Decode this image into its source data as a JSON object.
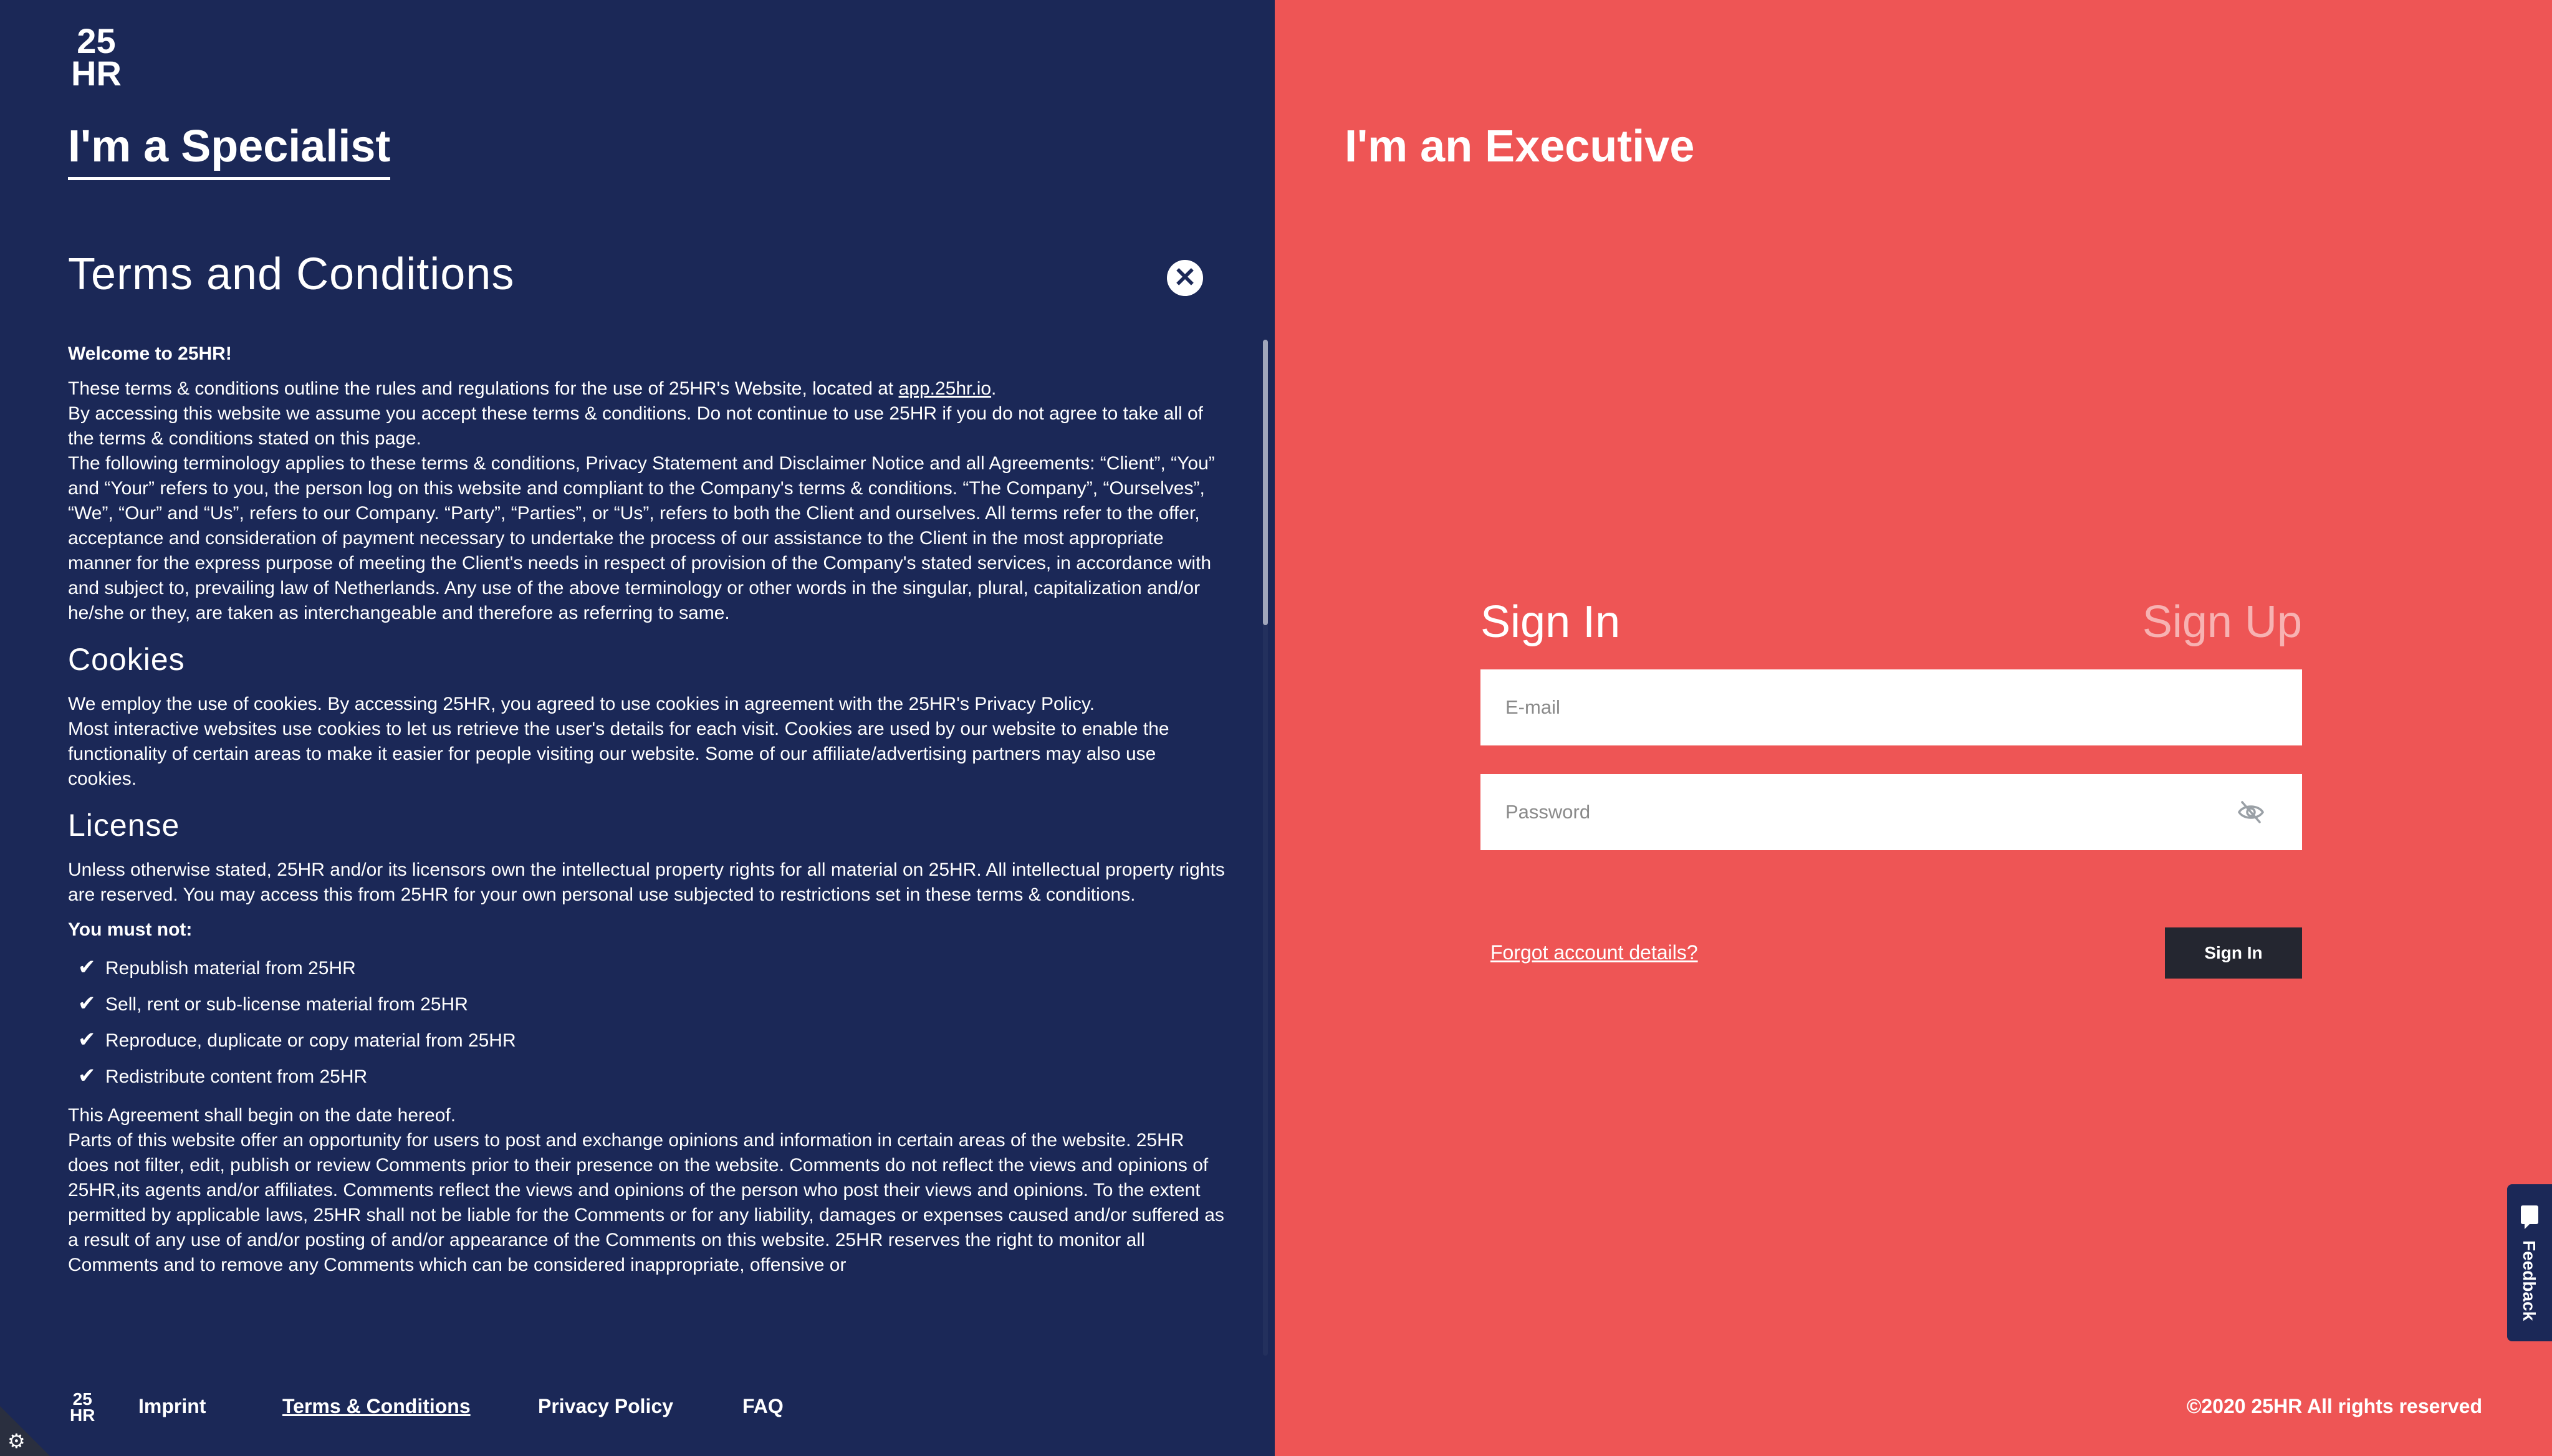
{
  "brand": {
    "logo_line1": "25",
    "logo_line2": "HR"
  },
  "left_panel": {
    "title": "I'm a Specialist",
    "modal_title": "Terms and Conditions",
    "welcome": "Welcome to 25HR!",
    "intro_prefix": "These terms & conditions outline the rules and regulations for the use of 25HR's Website, located at ",
    "intro_link": "app.25hr.io",
    "intro_suffix": ".",
    "p2": "By accessing this website we assume you accept these terms & conditions. Do not continue to use 25HR if you do not agree to take all of the terms & conditions stated on this page.",
    "p3": "The following terminology applies to these terms & conditions, Privacy Statement and Disclaimer Notice and all Agreements: “Client”, “You” and “Your” refers to you, the person log on this website and compliant to the Company's terms & conditions. “The Company”, “Ourselves”, “We”, “Our” and “Us”, refers to our Company. “Party”, “Parties”, or “Us”, refers to both the Client and ourselves. All terms refer to the offer, acceptance and consideration of payment necessary to undertake the process of our assistance to the Client in the most appropriate manner for the express purpose of meeting the Client's needs in respect of provision of the Company's stated services, in accordance with and subject to, prevailing law of Netherlands. Any use of the above terminology or other words in the singular, plural, capitalization and/or he/she or they, are taken as interchangeable and therefore as referring to same.",
    "cookies_heading": "Cookies",
    "cookies_p1": "We employ the use of cookies. By accessing 25HR, you agreed to use cookies in agreement with the 25HR's Privacy Policy.",
    "cookies_p2": "Most interactive websites use cookies to let us retrieve the user's details for each visit. Cookies are used by our website to enable the functionality of certain areas to make it easier for people visiting our website. Some of our affiliate/advertising partners may also use cookies.",
    "license_heading": "License",
    "license_p1": "Unless otherwise stated, 25HR and/or its licensors own the intellectual property rights for all material on 25HR. All intellectual property rights are reserved. You may access this from 25HR for your own personal use subjected to restrictions set in these terms & conditions.",
    "must_not": "You must not:",
    "check_glyph": "✔",
    "must_not_items": [
      "Republish material from 25HR",
      "Sell, rent or sub-license material from 25HR",
      "Reproduce, duplicate or copy material from 25HR",
      "Redistribute content from 25HR"
    ],
    "agreement_p": "This Agreement shall begin on the date hereof.",
    "comments_p": "Parts of this website offer an opportunity for users to post and exchange opinions and information in certain areas of the website. 25HR does not filter, edit, publish or review Comments prior to their presence on the website. Comments do not reflect the views and opinions of 25HR,its agents and/or affiliates. Comments reflect the views and opinions of the person who post their views and opinions. To the extent permitted by applicable laws, 25HR shall not be liable for the Comments or for any liability, damages or expenses caused and/or suffered as a result of any use of and/or posting of and/or appearance of the Comments on this website. 25HR reserves the right to monitor all Comments and to remove any Comments which can be considered inappropriate, offensive or"
  },
  "footer": {
    "links": [
      "Imprint",
      "Terms & Conditions",
      "Privacy Policy",
      "FAQ"
    ],
    "copyright": "©2020 25HR All rights reserved"
  },
  "right_panel": {
    "title": "I'm an Executive",
    "tab_signin": "Sign In",
    "tab_signup": "Sign Up",
    "email_placeholder": "E-mail",
    "password_placeholder": "Password",
    "forgot": "Forgot account details?",
    "signin_button": "Sign In",
    "feedback": "Feedback"
  },
  "icons": {
    "close": "close-icon",
    "eye": "eye-off-icon",
    "feedback": "chat-icon",
    "settings": "gear-icon"
  },
  "colors": {
    "navy": "#1b2857",
    "coral": "#ee5555",
    "button_dark": "#242630"
  }
}
